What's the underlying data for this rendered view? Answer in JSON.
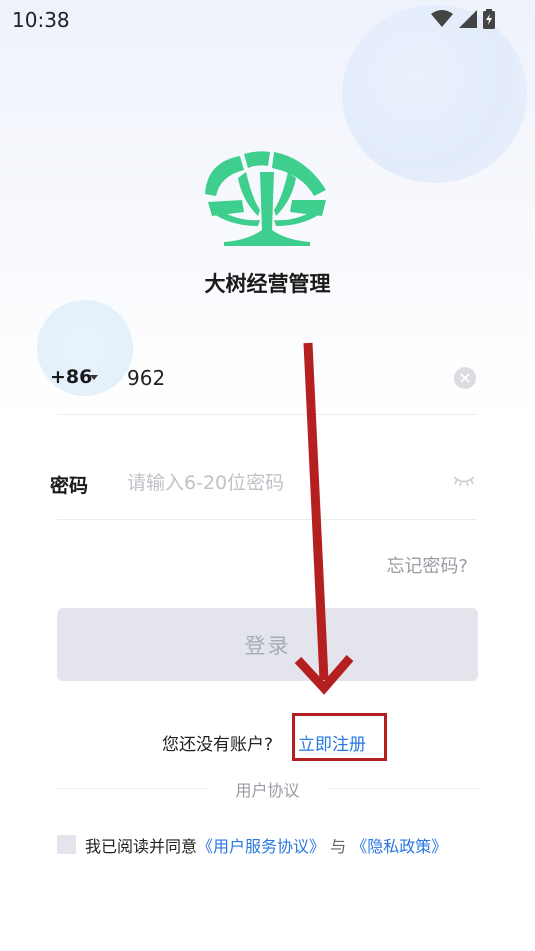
{
  "status_bar": {
    "time": "10:38"
  },
  "app": {
    "name": "大树经营管理"
  },
  "phone": {
    "country_code": "+86",
    "value": "962"
  },
  "password": {
    "label": "密码",
    "placeholder": "请输入6-20位密码"
  },
  "forgot_password": "忘记密码?",
  "login_button": "登录",
  "register": {
    "prompt": "您还没有账户?",
    "link": "立即注册"
  },
  "user_agreement": "用户协议",
  "consent": {
    "prefix": "我已阅读并同意",
    "service_agreement": "《用户服务协议》",
    "conjunction": "与",
    "privacy_policy": "《隐私政策》"
  },
  "colors": {
    "accent": "#2a77e0",
    "logo_green": "#3ecf8e",
    "annotation_red": "#b42020"
  }
}
